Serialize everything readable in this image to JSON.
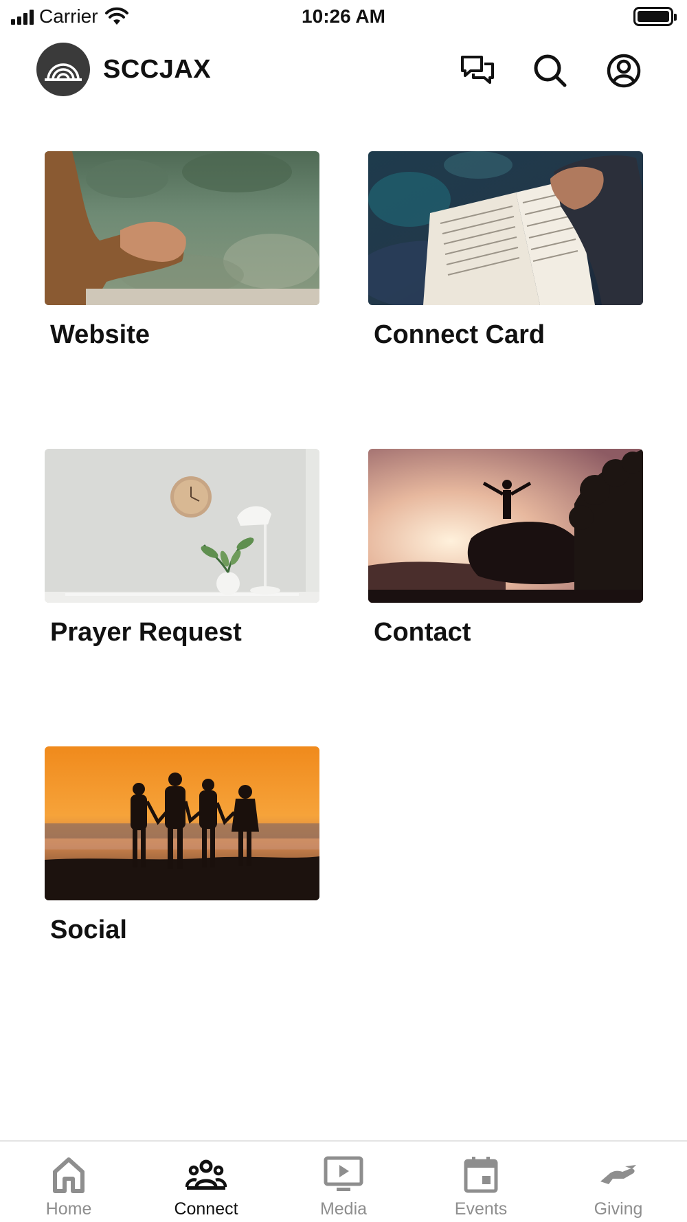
{
  "status_bar": {
    "carrier": "Carrier",
    "time": "10:26 AM"
  },
  "header": {
    "brand": "SCCJAX",
    "icons": [
      "chat-icon",
      "search-icon",
      "account-icon"
    ]
  },
  "tiles": [
    {
      "label": "Website",
      "image": "hands-clasped-lake-photo"
    },
    {
      "label": "Connect Card",
      "image": "open-bible-photo"
    },
    {
      "label": "Prayer Request",
      "image": "clock-plant-lamp-photo"
    },
    {
      "label": "Contact",
      "image": "person-on-rock-sunset-photo"
    },
    {
      "label": "Social",
      "image": "friends-holding-hands-sunset-photo"
    }
  ],
  "tab_bar": {
    "active": "Connect",
    "tabs": [
      {
        "label": "Home",
        "icon": "home-icon"
      },
      {
        "label": "Connect",
        "icon": "people-group-icon"
      },
      {
        "label": "Media",
        "icon": "play-screen-icon"
      },
      {
        "label": "Events",
        "icon": "calendar-icon"
      },
      {
        "label": "Giving",
        "icon": "giving-hand-icon"
      }
    ]
  },
  "colors": {
    "active_tab": "#111111",
    "inactive_tab": "#8e8e8e",
    "logo_bg": "#3a3a3a"
  }
}
